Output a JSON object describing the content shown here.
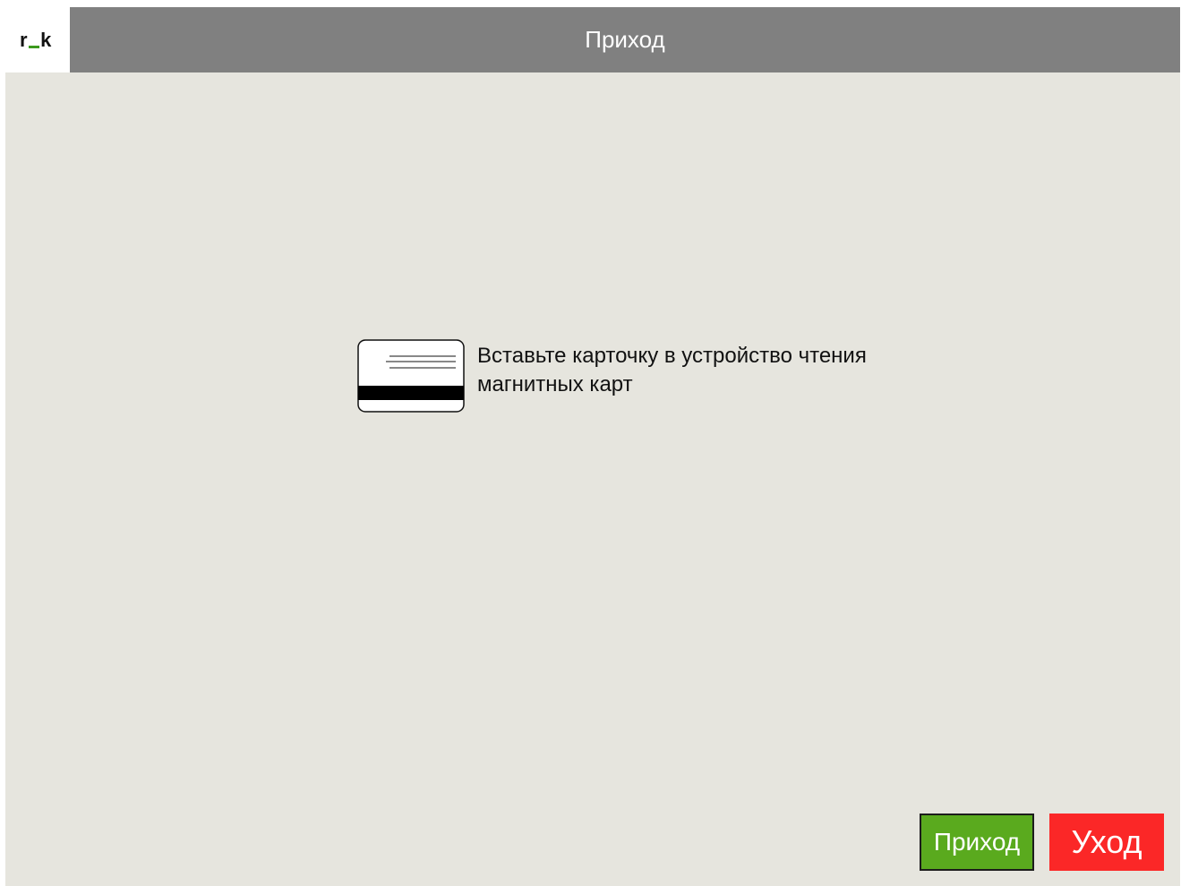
{
  "app": {
    "logo_prefix": "r",
    "logo_suffix": "k",
    "title": "Приход"
  },
  "main": {
    "message_line1": "Вставьте карточку в устройство чтения",
    "message_line2": "магнитных карт",
    "icon": "magnetic-card-icon"
  },
  "buttons": {
    "enter_label": "Приход",
    "exit_label": "Уход"
  },
  "colors": {
    "header": "#808080",
    "background": "#e6e5de",
    "enter_button": "#5aaa1e",
    "exit_button": "#fb2727",
    "logo_accent": "#3c9a1e"
  }
}
